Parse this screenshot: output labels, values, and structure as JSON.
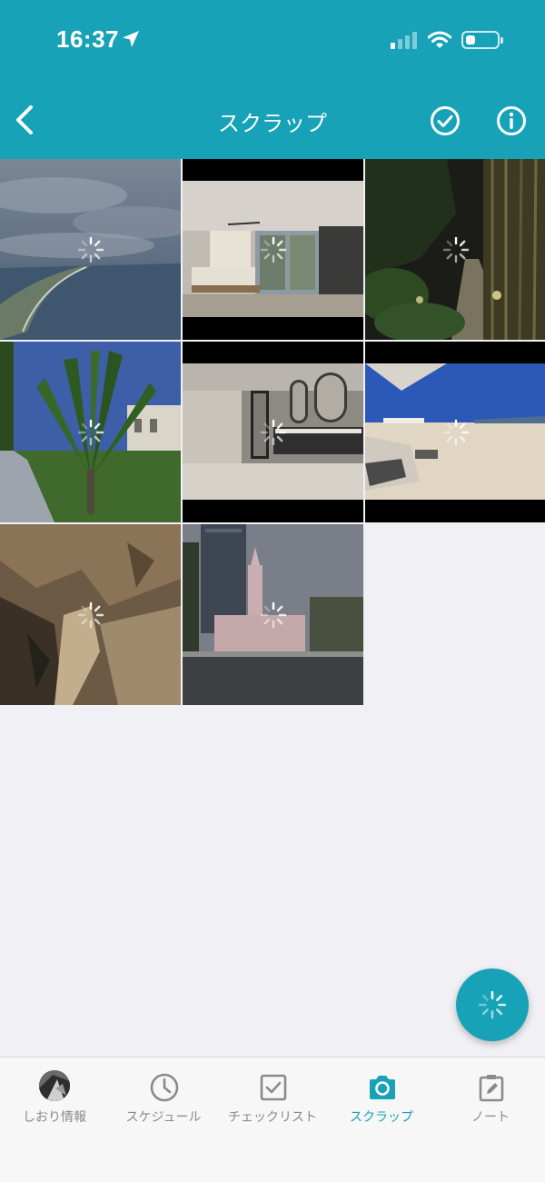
{
  "status_bar": {
    "time": "16:37"
  },
  "header": {
    "title": "スクラップ"
  },
  "photos": [
    {
      "name": "photo-coast-clouds",
      "loading": true
    },
    {
      "name": "photo-villa-bedroom",
      "loading": true
    },
    {
      "name": "photo-bamboo-path-night",
      "loading": true
    },
    {
      "name": "photo-travelers-palm",
      "loading": true
    },
    {
      "name": "photo-bathroom-mirrors",
      "loading": true
    },
    {
      "name": "photo-beach-loungers",
      "loading": true
    },
    {
      "name": "photo-cave-rock",
      "loading": true
    },
    {
      "name": "photo-pink-church",
      "loading": true
    }
  ],
  "tabs": [
    {
      "label": "しおり情報",
      "icon": "avatar-icon",
      "active": false
    },
    {
      "label": "スケジュール",
      "icon": "clock-icon",
      "active": false
    },
    {
      "label": "チェックリスト",
      "icon": "checkbox-icon",
      "active": false
    },
    {
      "label": "スクラップ",
      "icon": "camera-icon",
      "active": true
    },
    {
      "label": "ノート",
      "icon": "note-edit-icon",
      "active": false
    }
  ],
  "colors": {
    "accent": "#17a2b8",
    "background": "#f0f0f5",
    "tab_inactive": "#8a8a8a"
  }
}
